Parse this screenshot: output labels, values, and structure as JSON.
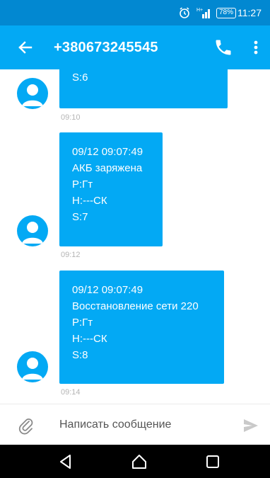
{
  "status_bar": {
    "battery": "78%",
    "time": "11:27",
    "icons": [
      "alarm-icon",
      "signal-icon",
      "battery-icon"
    ]
  },
  "app_bar": {
    "title": "+380673245545",
    "icons": [
      "back-arrow-icon",
      "phone-icon",
      "more-vert-icon"
    ]
  },
  "messages": [
    {
      "lines": [
        "S:6"
      ],
      "time": "09:10"
    },
    {
      "lines": [
        "09/12 09:07:49",
        "АКБ заряжена",
        "P:Гт",
        "H:---СК",
        "S:7"
      ],
      "time": "09:12"
    },
    {
      "lines": [
        "09/12 09:07:49",
        "Восстановление сети 220",
        "P:Гт",
        "H:---СК",
        "S:8"
      ],
      "time": "09:14"
    }
  ],
  "compose": {
    "placeholder": "Написать сообщение",
    "icons": [
      "attach-icon",
      "send-icon"
    ]
  },
  "nav_bar": {
    "icons": [
      "nav-back-icon",
      "nav-home-icon",
      "nav-recents-icon"
    ]
  },
  "colors": {
    "status_bar": "#0288d1",
    "app_bar": "#03a9f4",
    "bubble": "#03a9f4",
    "timestamp": "#b5b5b5"
  }
}
